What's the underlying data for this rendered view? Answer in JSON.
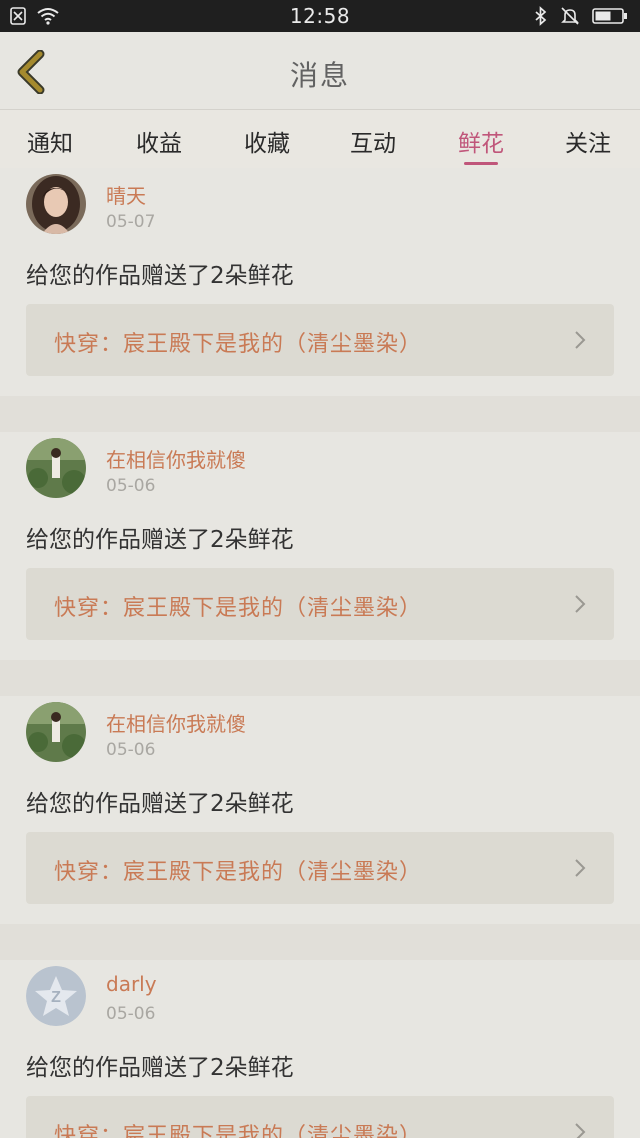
{
  "status_bar": {
    "time": "12:58",
    "left_icons": [
      "sim-icon",
      "wifi-icon"
    ],
    "right_icons": [
      "bluetooth-icon",
      "mute-bell-icon",
      "battery-icon"
    ]
  },
  "header": {
    "title": "消息",
    "back_icon": "chevron-left-icon",
    "back_color": "#a58a2e"
  },
  "tabs": [
    {
      "label": "通知",
      "active": false
    },
    {
      "label": "收益",
      "active": false
    },
    {
      "label": "收藏",
      "active": false
    },
    {
      "label": "互动",
      "active": false
    },
    {
      "label": "鲜花",
      "active": true
    },
    {
      "label": "关注",
      "active": false
    }
  ],
  "accent_color": "#c0567a",
  "link_color": "#c97a55",
  "messages": [
    {
      "user": "晴天",
      "date": "05-07",
      "text": "给您的作品赠送了2朵鲜花",
      "book": "快穿：宸王殿下是我的（清尘墨染）",
      "avatar": "photo-avatar-girl"
    },
    {
      "user": "在相信你我就傻",
      "date": "05-06",
      "text": "给您的作品赠送了2朵鲜花",
      "book": "快穿：宸王殿下是我的（清尘墨染）",
      "avatar": "photo-avatar-field"
    },
    {
      "user": "在相信你我就傻",
      "date": "05-06",
      "text": "给您的作品赠送了2朵鲜花",
      "book": "快穿：宸王殿下是我的（清尘墨染）",
      "avatar": "photo-avatar-field"
    },
    {
      "user": "darly",
      "date": "05-06",
      "text": "给您的作品赠送了2朵鲜花",
      "book": "快穿：宸王殿下是我的（清尘墨染）",
      "avatar": "default-avatar-icon"
    }
  ]
}
